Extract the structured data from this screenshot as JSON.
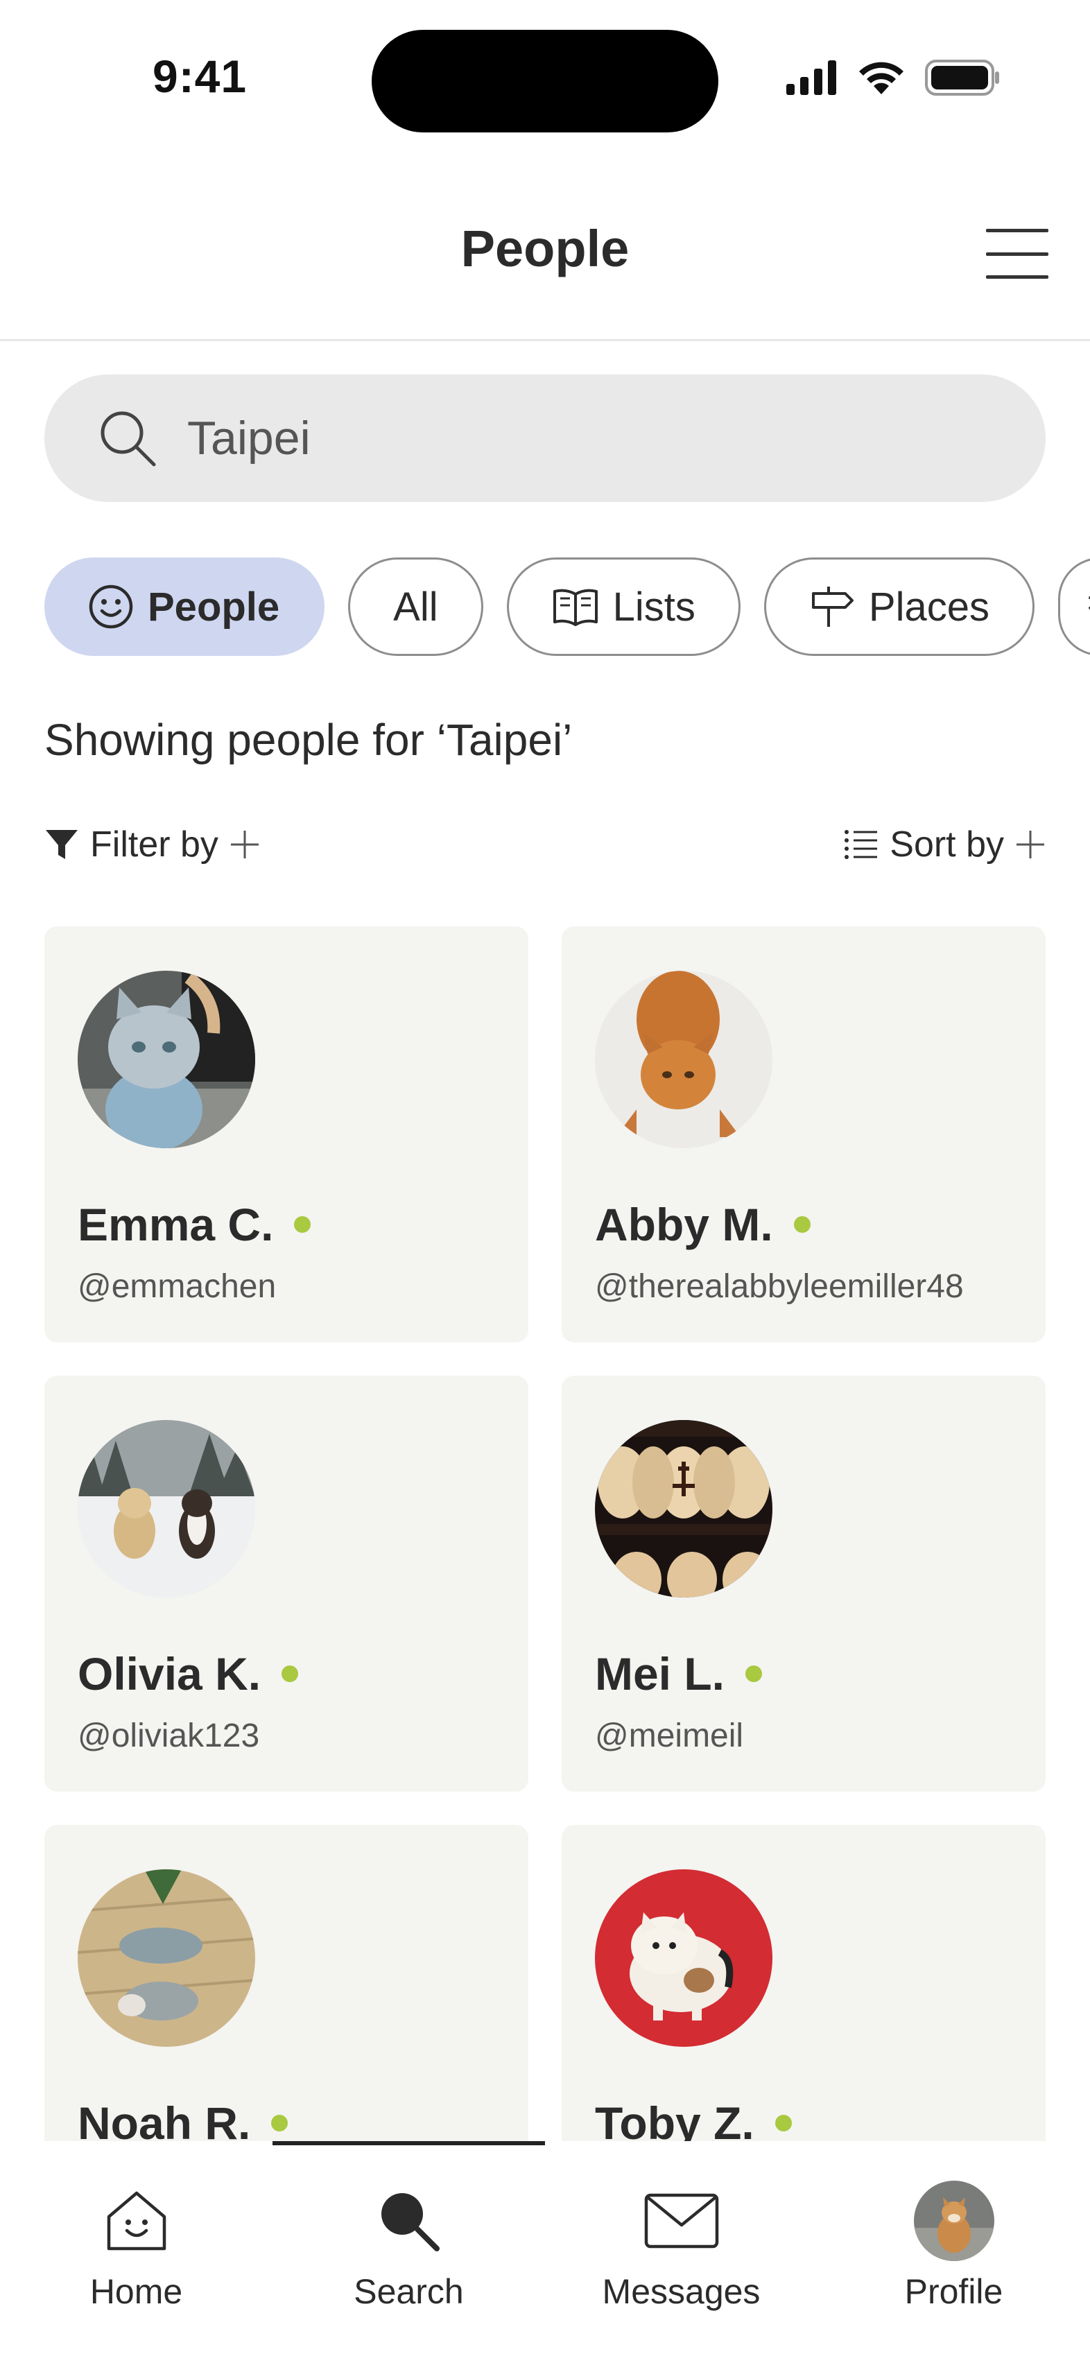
{
  "status_bar": {
    "time": "9:41"
  },
  "header": {
    "title": "People",
    "menu_icon": "hamburger-menu-icon"
  },
  "search": {
    "value": "Taipei",
    "icon": "search-icon"
  },
  "chips": [
    {
      "label": "People",
      "icon": "smiley-icon",
      "active": true
    },
    {
      "label": "All",
      "icon": "",
      "active": false
    },
    {
      "label": "Lists",
      "icon": "book-icon",
      "active": false
    },
    {
      "label": "Places",
      "icon": "signpost-icon",
      "active": false
    }
  ],
  "result_summary": "Showing people for ‘Taipei’",
  "controls": {
    "filter_label": "Filter by",
    "sort_label": "Sort by"
  },
  "people": [
    {
      "name": "Emma C.",
      "handle": "@emmachen",
      "online": true
    },
    {
      "name": "Abby M.",
      "handle": "@therealabbyleemiller48",
      "online": true
    },
    {
      "name": "Olivia K.",
      "handle": "@oliviak123",
      "online": true
    },
    {
      "name": "Mei L.",
      "handle": "@meimeil",
      "online": true
    },
    {
      "name": "Noah R.",
      "handle": "",
      "online": true
    },
    {
      "name": "Toby Z.",
      "handle": "",
      "online": true
    }
  ],
  "tabs": [
    {
      "label": "Home",
      "icon": "home-icon",
      "active": false
    },
    {
      "label": "Search",
      "icon": "search-icon",
      "active": true
    },
    {
      "label": "Messages",
      "icon": "envelope-icon",
      "active": false
    },
    {
      "label": "Profile",
      "icon": "avatar-icon",
      "active": false
    }
  ],
  "colors": {
    "active_chip": "#cfd6f0",
    "online_dot": "#a8c940",
    "card_bg": "#f4f4f1",
    "search_bg": "#e9e9ea"
  }
}
